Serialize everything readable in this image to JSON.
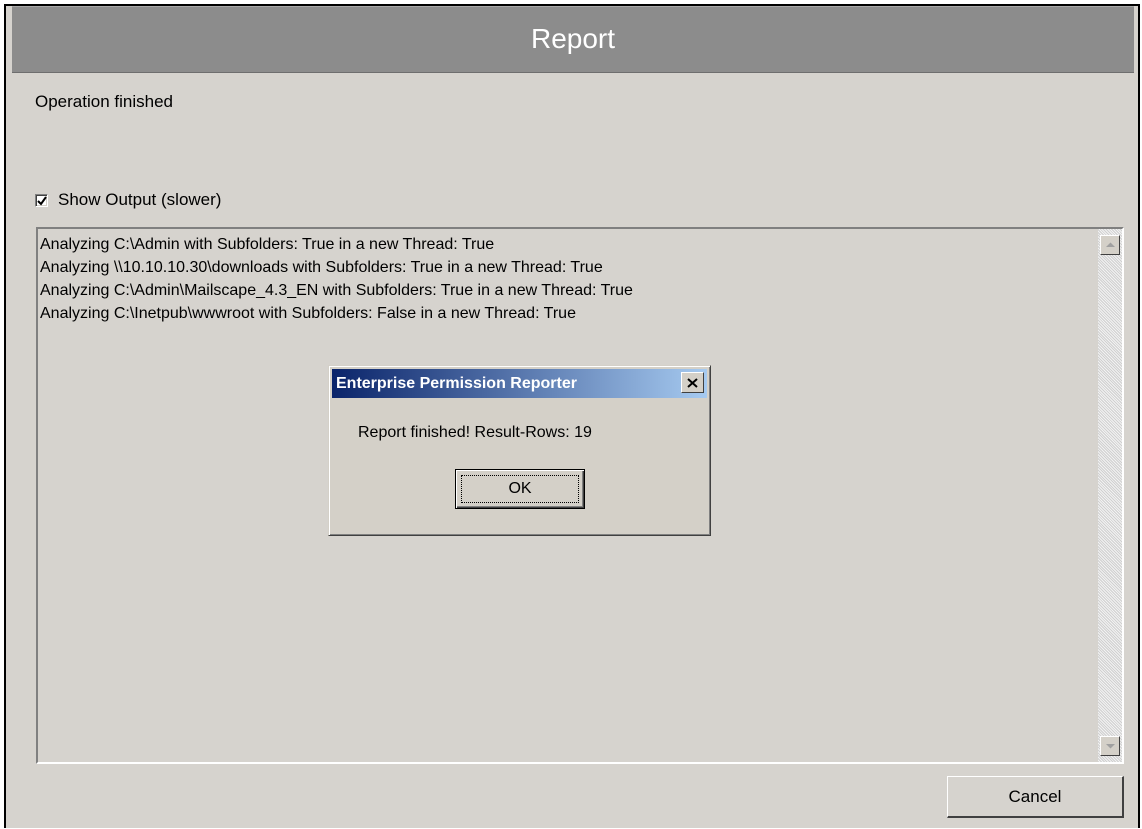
{
  "window": {
    "title": "Report"
  },
  "status_text": "Operation finished",
  "show_output": {
    "label": "Show Output (slower)",
    "checked": true
  },
  "output_lines": [
    "Analyzing C:\\Admin with Subfolders: True in a new Thread: True",
    "Analyzing \\\\10.10.10.30\\downloads with Subfolders: True in a new Thread: True",
    "Analyzing C:\\Admin\\Mailscape_4.3_EN with Subfolders: True in a new Thread: True",
    "Analyzing C:\\Inetpub\\wwwroot with Subfolders: False in a new Thread: True"
  ],
  "cancel_label": "Cancel",
  "dialog": {
    "title": "Enterprise Permission Reporter",
    "message": "Report finished! Result-Rows: 19",
    "ok_label": "OK"
  },
  "icons": {
    "checkbox": "checkmark-icon",
    "scroll_up": "scroll-up-arrow-icon",
    "scroll_down": "scroll-down-arrow-icon",
    "dialog_close": "close-icon"
  }
}
